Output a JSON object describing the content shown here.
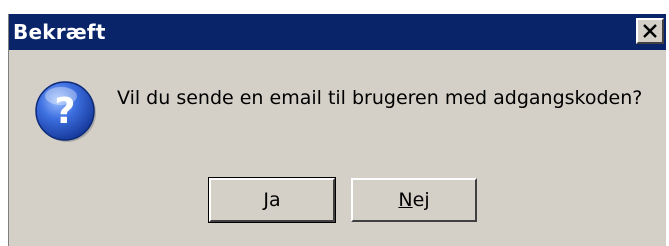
{
  "dialog": {
    "title": "Bekræft",
    "message": "Vil du sende en email til brugeren med adgangskoden?",
    "icon": "question-icon",
    "close_glyph": "✕"
  },
  "buttons": {
    "yes": {
      "mnemonic": "J",
      "rest": "a",
      "label": "Ja"
    },
    "no": {
      "mnemonic": "N",
      "rest": "ej",
      "label": "Nej"
    }
  },
  "colors": {
    "titlebar": "#0a246a",
    "dialog_bg": "#d4d0c8",
    "icon_blue": "#2a5bd7"
  }
}
